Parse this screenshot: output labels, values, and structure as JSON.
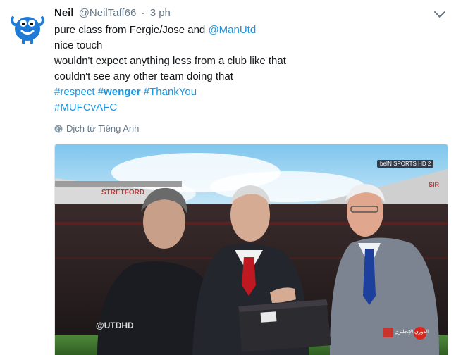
{
  "tweet": {
    "name": "Neil",
    "handle": "@NeilTaff66",
    "separator": "·",
    "time": "3 ph",
    "lines": {
      "l1_text": "pure class from Fergie/Jose and ",
      "l1_mention": "@ManUtd",
      "l2": "nice touch",
      "l3": "wouldn't expect anything less from a club like that",
      "l4": "couldn't see any other team doing that",
      "tag1_hash": "#",
      "tag1_word": "respect",
      "tag2_hash": "#",
      "tag2_word": "wenger",
      "tag3": "#ThankYou",
      "tag4": "#MUFCvAFC"
    },
    "translate_label": "Dịch từ Tiếng Anh"
  },
  "photo": {
    "broadcaster_badge": "beIN SPORTS HD 2",
    "watermark": "@UTDHD",
    "stadium_sign": "STRETFORD",
    "stadium_sign_right": "SIR",
    "bottom_right_caption": "الدوري الإنجليزي"
  },
  "colors": {
    "link": "#1b95e0",
    "muted": "#657786",
    "text": "#14171a"
  },
  "icons": {
    "caret": "chevron-down-icon",
    "globe": "globe-icon"
  }
}
